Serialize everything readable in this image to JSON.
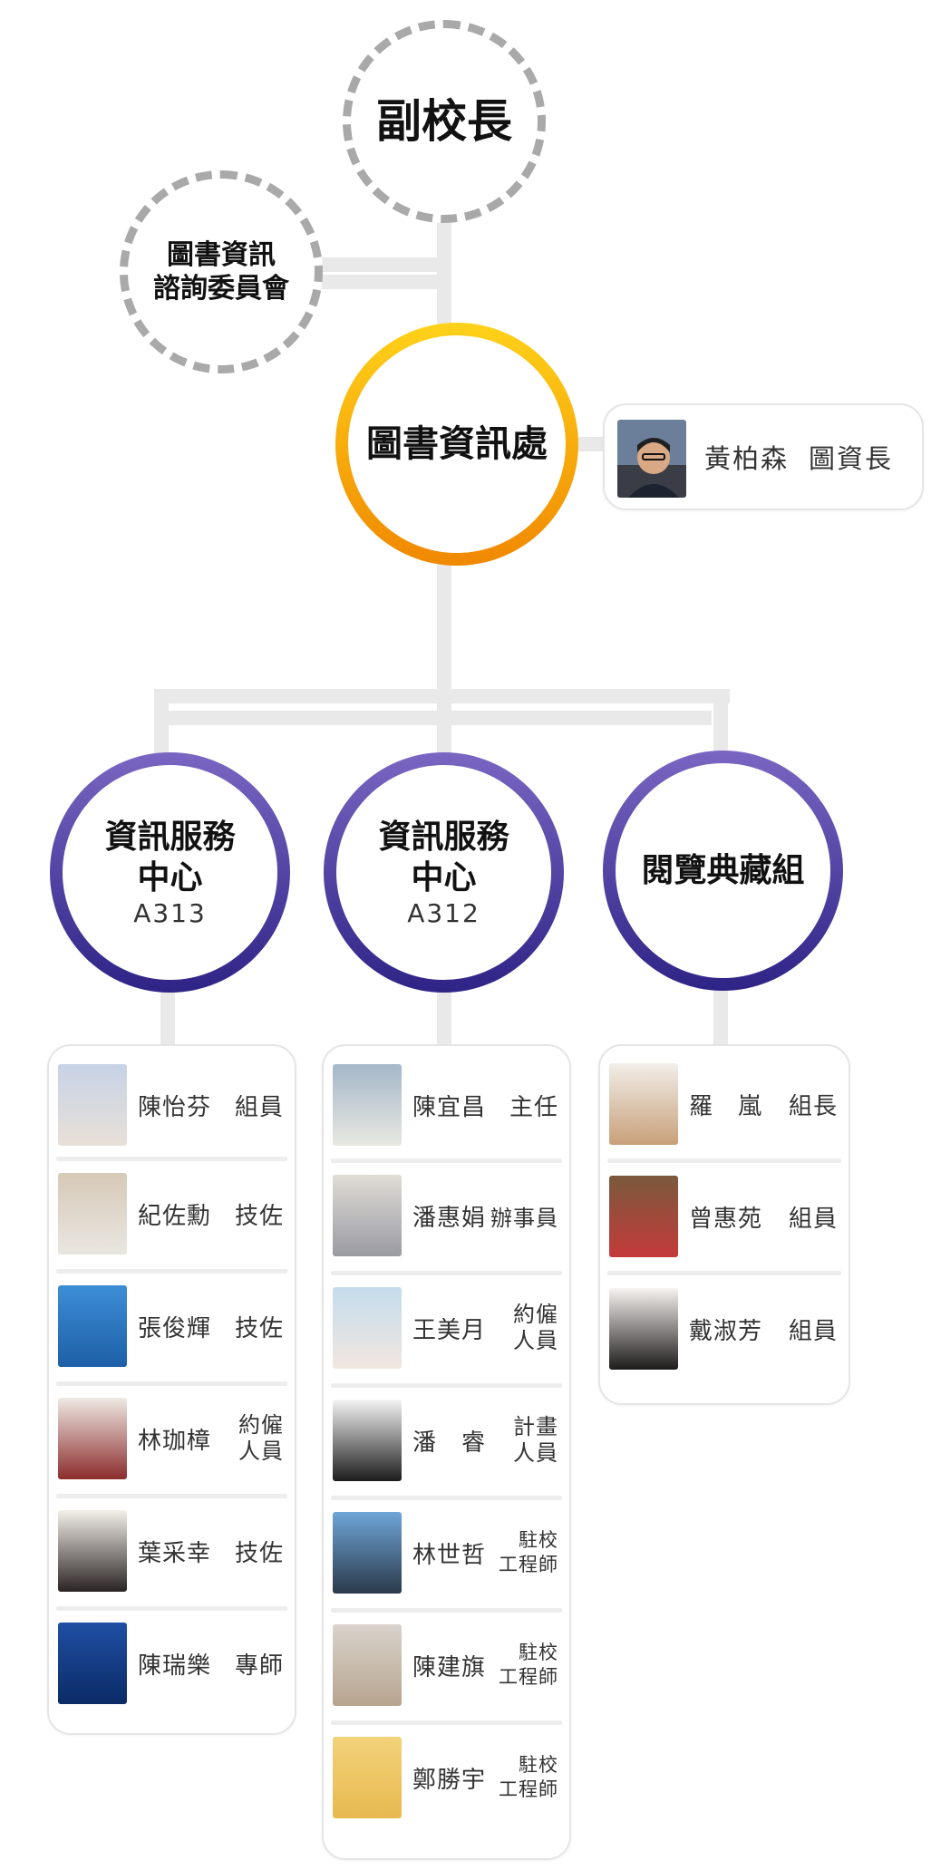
{
  "top": {
    "vice_president": "副校長",
    "committee": "圖書資訊\n諮詢委員會"
  },
  "office": {
    "title": "圖書資訊處",
    "director_name": "黃柏森",
    "director_title": "圖資長"
  },
  "departments": [
    {
      "title": "資訊服務\n中心",
      "room": "A313",
      "staff": [
        {
          "name": "陳怡芬",
          "title": "組員"
        },
        {
          "name": "紀佐勳",
          "title": "技佐"
        },
        {
          "name": "張俊輝",
          "title": "技佐"
        },
        {
          "name": "林珈樟",
          "title": "約僱\n人員"
        },
        {
          "name": "葉采幸",
          "title": "技佐"
        },
        {
          "name": "陳瑞樂",
          "title": "專師"
        }
      ]
    },
    {
      "title": "資訊服務\n中心",
      "room": "A312",
      "staff": [
        {
          "name": "陳宜昌",
          "title": "主任"
        },
        {
          "name": "潘惠娟",
          "title": "辦事員"
        },
        {
          "name": "王美月",
          "title": "約僱\n人員"
        },
        {
          "name": "潘　睿",
          "title": "計畫\n人員"
        },
        {
          "name": "林世哲",
          "title": "駐校\n工程師"
        },
        {
          "name": "陳建旗",
          "title": "駐校\n工程師"
        },
        {
          "name": "鄭勝宇",
          "title": "駐校\n工程師"
        }
      ]
    },
    {
      "title": "閱覽典藏組",
      "room": "",
      "staff": [
        {
          "name": "羅　嵐",
          "title": "組長"
        },
        {
          "name": "曾惠苑",
          "title": "組員"
        },
        {
          "name": "戴淑芳",
          "title": "組員"
        }
      ]
    }
  ],
  "colors": {
    "dashed": "#a9a9a9",
    "office_ring_top": "#ffd21a",
    "office_ring_bottom": "#f08800",
    "dept_ring_top": "#7a66c2",
    "dept_ring_bottom": "#2e2486",
    "connector": "#eeeeee"
  }
}
